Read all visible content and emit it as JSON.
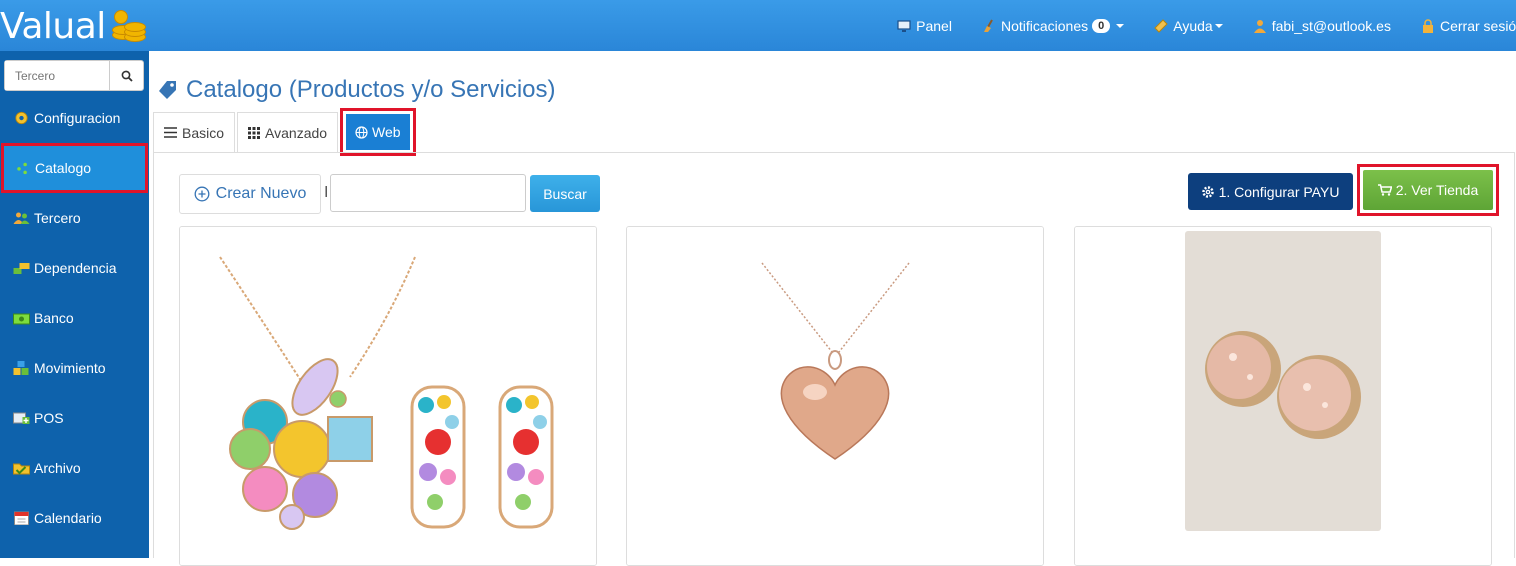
{
  "app": {
    "logo_text": "Valual"
  },
  "topnav": {
    "panel": "Panel",
    "notifications": "Notificaciones",
    "notifications_count": "0",
    "help": "Ayuda",
    "user": "fabi_st@outlook.es",
    "logout": "Cerrar sesión"
  },
  "sidebar": {
    "search_placeholder": "Tercero",
    "items": [
      {
        "label": "Configuracion",
        "icon": "gear-icon"
      },
      {
        "label": "Catalogo",
        "icon": "dots-icon"
      },
      {
        "label": "Tercero",
        "icon": "people-icon"
      },
      {
        "label": "Dependencia",
        "icon": "blocks-icon"
      },
      {
        "label": "Banco",
        "icon": "bank-icon"
      },
      {
        "label": "Movimiento",
        "icon": "boxes-icon"
      },
      {
        "label": "POS",
        "icon": "pos-icon"
      },
      {
        "label": "Archivo",
        "icon": "folder-icon"
      },
      {
        "label": "Calendario",
        "icon": "calendar-icon"
      }
    ]
  },
  "page": {
    "title": "Catalogo (Productos y/o Servicios)",
    "tabs": [
      {
        "label": "Basico"
      },
      {
        "label": "Avanzado"
      },
      {
        "label": "Web"
      }
    ]
  },
  "toolbar": {
    "new_label": "Crear Nuevo",
    "separator": "I",
    "search_value": "",
    "search_button": "Buscar",
    "payu_button": "1. Configurar PAYU",
    "store_button": "2. Ver Tienda"
  },
  "products": [
    {
      "image": "necklace-earrings-set"
    },
    {
      "image": "heart-pendant"
    },
    {
      "image": "druzy-earrings"
    }
  ],
  "colors": {
    "topbar": "#2a86d8",
    "sidebar": "#0e62ac",
    "accent": "#1a7fd4",
    "highlight": "#e0142a",
    "store_green": "#5ea536",
    "payu_navy": "#0d3f7e"
  }
}
